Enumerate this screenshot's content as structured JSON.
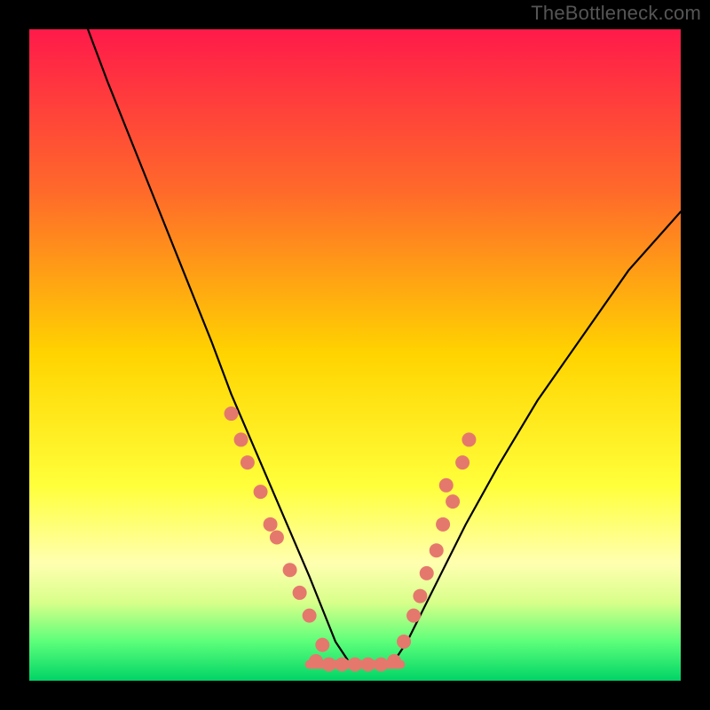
{
  "watermark": "TheBottleneck.com",
  "chart_data": {
    "type": "line",
    "title": "",
    "xlabel": "",
    "ylabel": "",
    "xlim": [
      0,
      100
    ],
    "ylim": [
      0,
      100
    ],
    "gradient_stops": [
      {
        "offset": 0,
        "color": "#ff1a4a"
      },
      {
        "offset": 25,
        "color": "#ff6a2a"
      },
      {
        "offset": 50,
        "color": "#ffd400"
      },
      {
        "offset": 70,
        "color": "#ffff3a"
      },
      {
        "offset": 82,
        "color": "#ffffb0"
      },
      {
        "offset": 88,
        "color": "#d8ff8a"
      },
      {
        "offset": 94,
        "color": "#5cff7a"
      },
      {
        "offset": 100,
        "color": "#00d466"
      }
    ],
    "series": [
      {
        "name": "left-curve",
        "color": "#000000",
        "x": [
          9,
          12,
          16,
          20,
          24,
          28,
          31,
          34,
          37,
          40,
          43,
          45,
          47,
          49
        ],
        "y": [
          100,
          92,
          82,
          72,
          62,
          52,
          44,
          37,
          30,
          23,
          16,
          11,
          6,
          3
        ]
      },
      {
        "name": "right-curve",
        "color": "#000000",
        "x": [
          56,
          58,
          60,
          63,
          67,
          72,
          78,
          85,
          92,
          100
        ],
        "y": [
          3,
          6,
          10,
          16,
          24,
          33,
          43,
          53,
          63,
          72
        ]
      },
      {
        "name": "flat-bottom",
        "color": "#e5786d",
        "x": [
          43,
          45,
          47,
          49,
          51,
          53,
          55,
          57
        ],
        "y": [
          2.5,
          2.5,
          2.5,
          2.5,
          2.5,
          2.5,
          2.5,
          2.5
        ]
      }
    ],
    "markers": [
      {
        "group": "left-dots",
        "x": 31.0,
        "y": 41.0
      },
      {
        "group": "left-dots",
        "x": 32.5,
        "y": 37.0
      },
      {
        "group": "left-dots",
        "x": 33.5,
        "y": 33.5
      },
      {
        "group": "left-dots",
        "x": 35.5,
        "y": 29.0
      },
      {
        "group": "left-dots",
        "x": 37.0,
        "y": 24.0
      },
      {
        "group": "left-dots",
        "x": 38.0,
        "y": 22.0
      },
      {
        "group": "left-dots",
        "x": 40.0,
        "y": 17.0
      },
      {
        "group": "left-dots",
        "x": 41.5,
        "y": 13.5
      },
      {
        "group": "left-dots",
        "x": 43.0,
        "y": 10.0
      },
      {
        "group": "left-dots",
        "x": 45.0,
        "y": 5.5
      },
      {
        "group": "bottom-dots",
        "x": 44.0,
        "y": 3.0
      },
      {
        "group": "bottom-dots",
        "x": 46.0,
        "y": 2.5
      },
      {
        "group": "bottom-dots",
        "x": 48.0,
        "y": 2.5
      },
      {
        "group": "bottom-dots",
        "x": 50.0,
        "y": 2.5
      },
      {
        "group": "bottom-dots",
        "x": 52.0,
        "y": 2.5
      },
      {
        "group": "bottom-dots",
        "x": 54.0,
        "y": 2.5
      },
      {
        "group": "bottom-dots",
        "x": 56.0,
        "y": 3.0
      },
      {
        "group": "right-dots",
        "x": 57.5,
        "y": 6.0
      },
      {
        "group": "right-dots",
        "x": 59.0,
        "y": 10.0
      },
      {
        "group": "right-dots",
        "x": 60.0,
        "y": 13.0
      },
      {
        "group": "right-dots",
        "x": 61.0,
        "y": 16.5
      },
      {
        "group": "right-dots",
        "x": 62.5,
        "y": 20.0
      },
      {
        "group": "right-dots",
        "x": 63.5,
        "y": 24.0
      },
      {
        "group": "right-dots",
        "x": 65.0,
        "y": 27.5
      },
      {
        "group": "right-dots",
        "x": 64.0,
        "y": 30.0
      },
      {
        "group": "right-dots",
        "x": 66.5,
        "y": 33.5
      },
      {
        "group": "right-dots",
        "x": 67.5,
        "y": 37.0
      }
    ],
    "marker_style": {
      "color": "#e5786d",
      "radius": 8
    }
  }
}
